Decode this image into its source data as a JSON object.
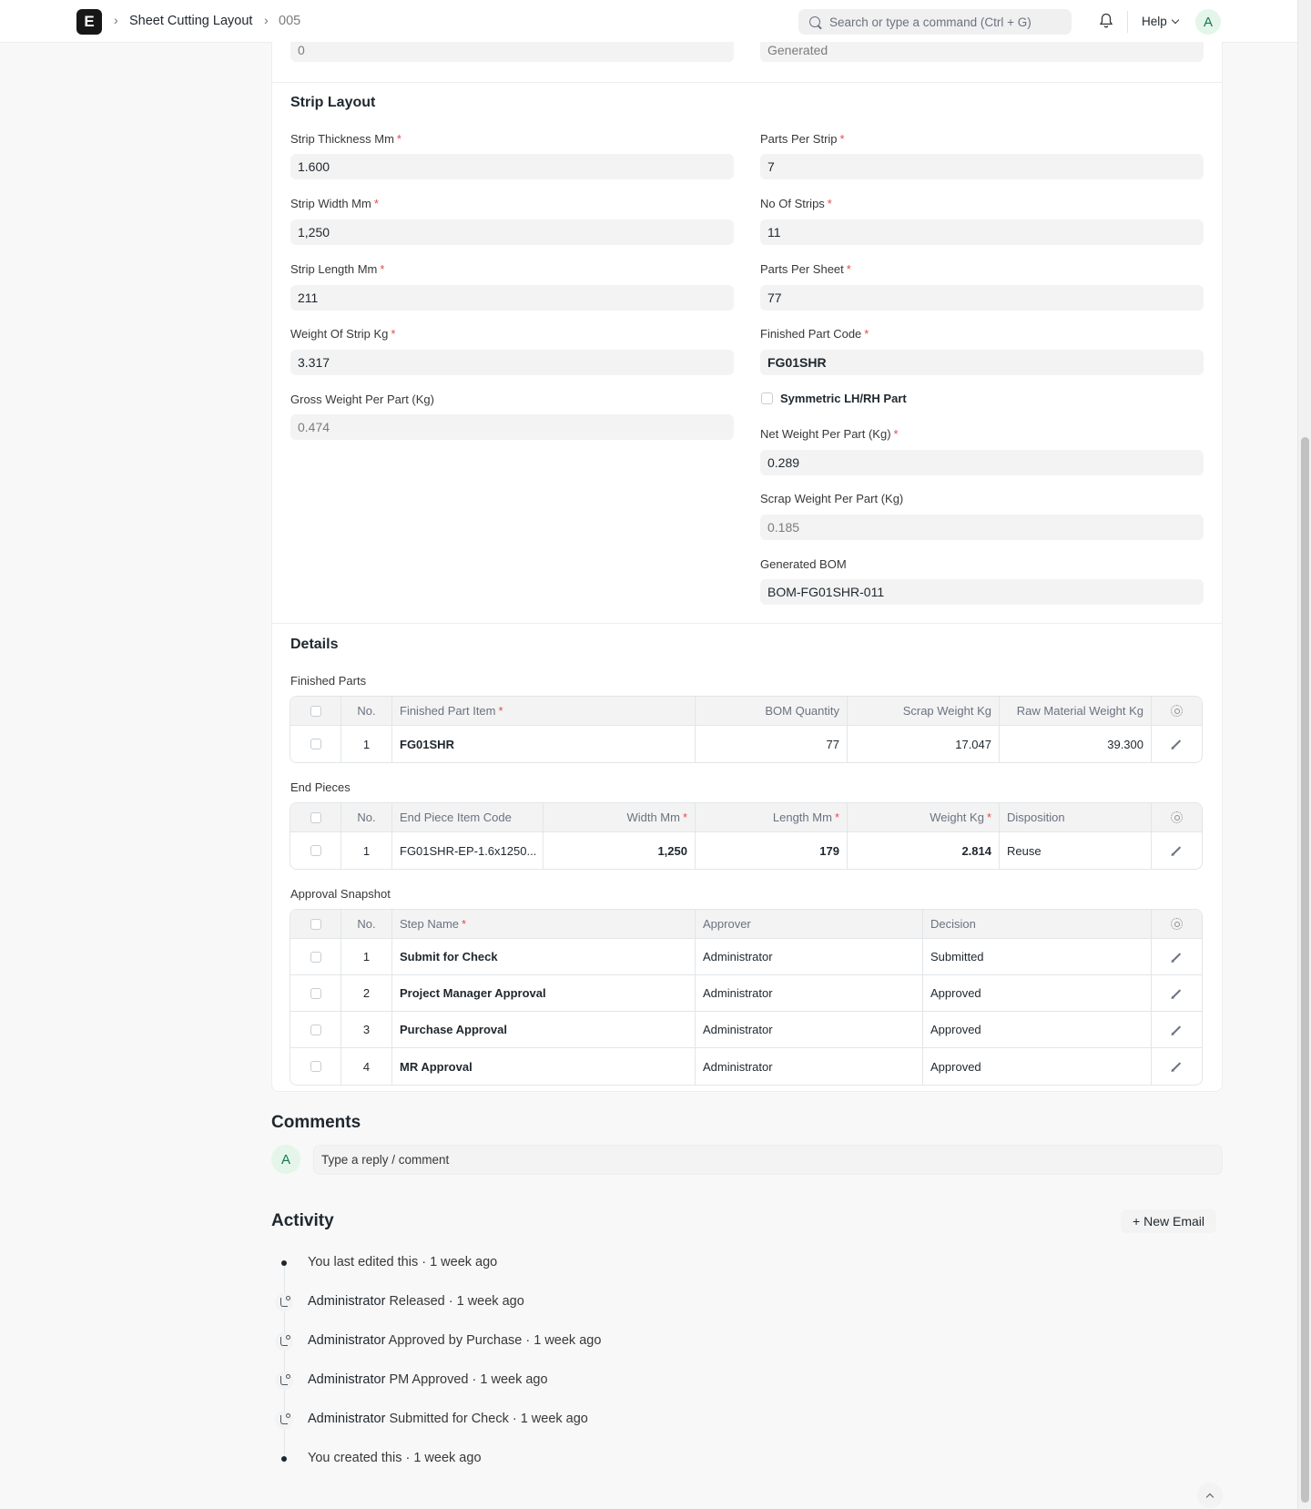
{
  "navbar": {
    "logo": "E",
    "breadcrumbs": [
      "Sheet Cutting Layout",
      "005"
    ],
    "search_placeholder": "Search or type a command (Ctrl + G)",
    "help_label": "Help",
    "avatar_initial": "A"
  },
  "top_partial": {
    "left_value": "0",
    "right_value": "Generated"
  },
  "strip_layout": {
    "title": "Strip Layout",
    "strip_thickness": {
      "label": "Strip Thickness Mm",
      "value": "1.600"
    },
    "strip_width": {
      "label": "Strip Width Mm",
      "value": "1,250"
    },
    "strip_length": {
      "label": "Strip Length Mm",
      "value": "211"
    },
    "weight_of_strip": {
      "label": "Weight Of Strip Kg",
      "value": "3.317"
    },
    "gross_weight": {
      "label": "Gross Weight Per Part (Kg)",
      "value": "0.474"
    },
    "parts_per_strip": {
      "label": "Parts Per Strip",
      "value": "7"
    },
    "no_of_strips": {
      "label": "No Of Strips",
      "value": "11"
    },
    "parts_per_sheet": {
      "label": "Parts Per Sheet",
      "value": "77"
    },
    "finished_part_code": {
      "label": "Finished Part Code",
      "value": "FG01SHR"
    },
    "symmetric_label": "Symmetric LH/RH Part",
    "net_weight": {
      "label": "Net Weight Per Part (Kg)",
      "value": "0.289"
    },
    "scrap_weight": {
      "label": "Scrap Weight Per Part (Kg)",
      "value": "0.185"
    },
    "generated_bom": {
      "label": "Generated BOM",
      "value": "BOM-FG01SHR-011"
    }
  },
  "details": {
    "title": "Details",
    "finished_parts": {
      "label": "Finished Parts",
      "headers": [
        "No.",
        "Finished Part Item",
        "BOM Quantity",
        "Scrap Weight Kg",
        "Raw Material Weight Kg"
      ],
      "rows": [
        {
          "no": "1",
          "item": "FG01SHR",
          "bom_qty": "77",
          "scrap": "17.047",
          "raw": "39.300"
        }
      ]
    },
    "end_pieces": {
      "label": "End Pieces",
      "headers": [
        "No.",
        "End Piece Item Code",
        "Width Mm",
        "Length Mm",
        "Weight Kg",
        "Disposition"
      ],
      "rows": [
        {
          "no": "1",
          "code": "FG01SHR-EP-1.6x1250...",
          "width": "1,250",
          "length": "179",
          "weight": "2.814",
          "disposition": "Reuse"
        }
      ]
    },
    "approval_snapshot": {
      "label": "Approval Snapshot",
      "headers": [
        "No.",
        "Step Name",
        "Approver",
        "Decision"
      ],
      "rows": [
        {
          "no": "1",
          "step": "Submit for Check",
          "approver": "Administrator",
          "decision": "Submitted"
        },
        {
          "no": "2",
          "step": "Project Manager Approval",
          "approver": "Administrator",
          "decision": "Approved"
        },
        {
          "no": "3",
          "step": "Purchase Approval",
          "approver": "Administrator",
          "decision": "Approved"
        },
        {
          "no": "4",
          "step": "MR Approval",
          "approver": "Administrator",
          "decision": "Approved"
        }
      ]
    }
  },
  "comments": {
    "title": "Comments",
    "avatar_initial": "A",
    "placeholder": "Type a reply / comment"
  },
  "activity": {
    "title": "Activity",
    "new_email_label": "+ New Email",
    "items": [
      {
        "actor": "",
        "text": "You last edited this · 1 week ago"
      },
      {
        "actor": "Administrator",
        "text": " Released · 1 week ago"
      },
      {
        "actor": "Administrator",
        "text": " Approved by Purchase · 1 week ago"
      },
      {
        "actor": "Administrator",
        "text": " PM Approved · 1 week ago"
      },
      {
        "actor": "Administrator",
        "text": " Submitted for Check · 1 week ago"
      },
      {
        "actor": "",
        "text": "You created this · 1 week ago"
      }
    ]
  }
}
